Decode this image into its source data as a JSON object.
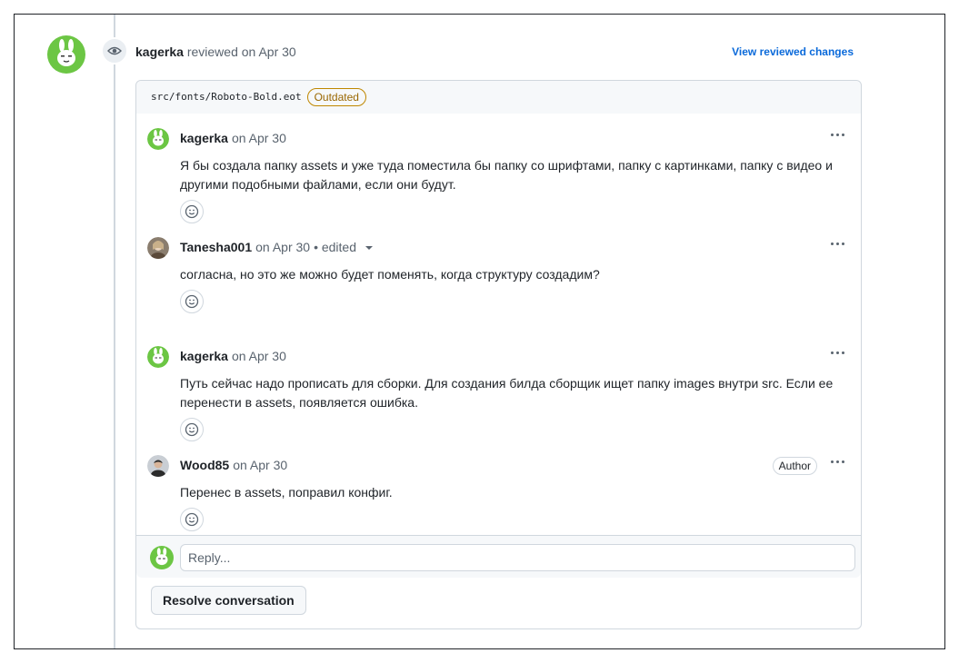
{
  "review": {
    "user": "kagerka",
    "action": "reviewed",
    "date": "on Apr 30",
    "view_changes_label": "View reviewed changes"
  },
  "file": {
    "path": "src/fonts/Roboto-Bold.eot",
    "status_badge": "Outdated"
  },
  "comments": [
    {
      "user": "kagerka",
      "date": "on Apr 30",
      "edited": "",
      "badge": "",
      "avatar": "bunny-avatar",
      "body": "Я бы создала папку assets и уже туда поместила бы папку со шрифтами, папку с картинками, папку с видео и другими подобными файлами, если они будут."
    },
    {
      "user": "Tanesha001",
      "date": "on Apr 30",
      "edited": "• edited",
      "badge": "",
      "avatar": "photo-avatar",
      "body": "согласна, но это же можно будет поменять, когда структуру создадим?"
    },
    {
      "user": "kagerka",
      "date": "on Apr 30",
      "edited": "",
      "badge": "",
      "avatar": "bunny-avatar",
      "body": "Путь сейчас надо прописать для сборки. Для создания билда сборщик ищет папку images внутри src. Если ее перенести в assets, появляется ошибка."
    },
    {
      "user": "Wood85",
      "date": "on Apr 30",
      "edited": "",
      "badge": "Author",
      "avatar": "photo-avatar",
      "body": "Перенес в assets, поправил конфиг."
    }
  ],
  "reply": {
    "placeholder": "Reply..."
  },
  "actions": {
    "resolve_label": "Resolve conversation"
  },
  "colors": {
    "accent_link": "#0969da",
    "outdated": "#9a6700",
    "avatar_green": "#6cc644",
    "border": "#d0d7de"
  }
}
